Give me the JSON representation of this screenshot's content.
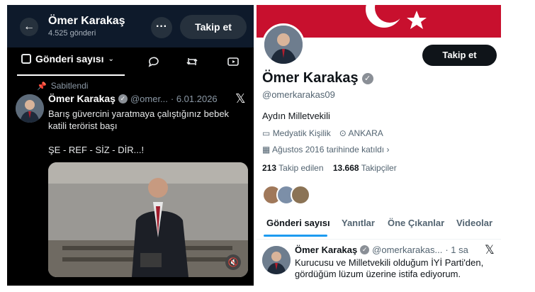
{
  "left": {
    "header": {
      "name": "Ömer Karakaş",
      "count": "4.525 gönderi",
      "follow": "Takip et",
      "more": "···",
      "back": "←"
    },
    "tabs": {
      "selected": "Gönderi sayısı"
    },
    "pinned": "Sabitlendi",
    "post": {
      "name": "Ömer Karakaş",
      "handle": "@omer...",
      "date": "· 6.01.2026",
      "line1": "Barış güvercini yaratmaya çalıştığınız bebek",
      "line2": "katili terörist başı",
      "line3": "ŞE - REF - SİZ - DİR...!"
    }
  },
  "right": {
    "follow": "Takip et",
    "name": "Ömer Karakaş",
    "handle": "@omerkarakas09",
    "bio": "Aydın Milletvekili",
    "category": "Medyatik Kişilik",
    "location": "ANKARA",
    "joined": "Ağustos 2016 tarihinde katıldı",
    "following_count": "213",
    "following_label": "Takip edilen",
    "followers_count": "13.668",
    "followers_label": "Takipçiler",
    "tabs": [
      "Gönderi sayısı",
      "Yanıtlar",
      "Öne Çıkanlar",
      "Videolar"
    ],
    "post": {
      "name": "Ömer Karakaş",
      "handle": "@omerkarakas...",
      "time": "· 1 sa",
      "line1": "Kurucusu ve Milletvekili olduğum İYİ Parti'den,",
      "line2": "gördüğüm lüzum üzerine istifa ediyorum."
    }
  },
  "colors": {
    "banner": "#c8102e",
    "accent": "#1d9bf0",
    "dark_bg": "#000000",
    "verified": "#8a8f96"
  }
}
